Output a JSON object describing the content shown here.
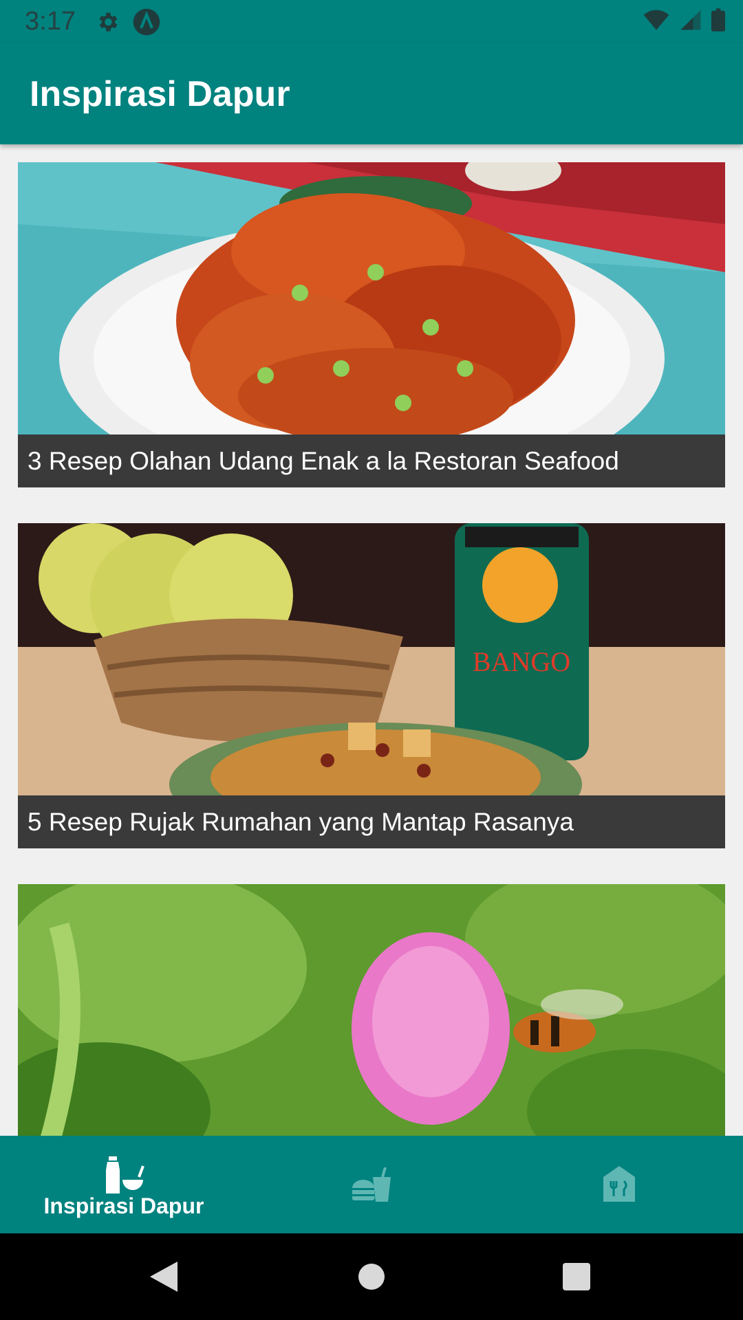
{
  "status_bar": {
    "time": "3:17",
    "icons": [
      "gear-icon",
      "a-badge-icon",
      "wifi-icon",
      "signal-icon",
      "battery-icon"
    ]
  },
  "app_bar": {
    "title": "Inspirasi Dapur"
  },
  "articles": [
    {
      "title": "3 Resep Olahan Udang Enak a la Restoran Seafood",
      "image": "shrimp-dish-photo"
    },
    {
      "title": "5 Resep Rujak Rumahan yang Mantap Rasanya",
      "image": "rujak-and-kecap-bottle-photo"
    },
    {
      "title": "",
      "image": "bee-on-clover-flower-photo"
    }
  ],
  "bottom_nav": {
    "items": [
      {
        "label": "Inspirasi Dapur",
        "icon": "kitchen-bottle-bowl-icon",
        "selected": true
      },
      {
        "label": "",
        "icon": "fastfood-icon",
        "selected": false
      },
      {
        "label": "",
        "icon": "restaurant-house-icon",
        "selected": false
      }
    ]
  },
  "colors": {
    "primary": "#00827f",
    "caption_bg": "#3a3a3a",
    "inactive_icon": "#5fb7b4"
  }
}
